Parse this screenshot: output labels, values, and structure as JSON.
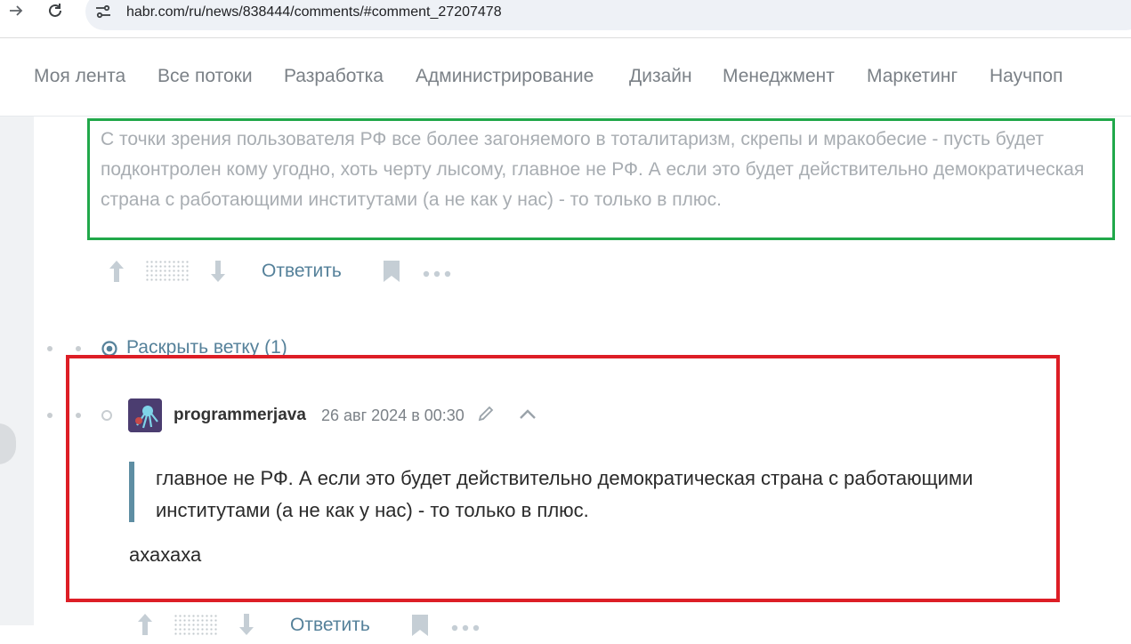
{
  "browser": {
    "url": "habr.com/ru/news/838444/comments/#comment_27207478"
  },
  "topnav": {
    "items": [
      {
        "label": "Моя лента"
      },
      {
        "label": "Все потоки"
      },
      {
        "label": "Разработка"
      },
      {
        "label": "Администрирование"
      },
      {
        "label": "Дизайн"
      },
      {
        "label": "Менеджмент"
      },
      {
        "label": "Маркетинг"
      },
      {
        "label": "Научпоп"
      }
    ]
  },
  "parent_comment": {
    "text": "С точки зрения пользователя РФ все более загоняемого в тоталитаризм, скрепы и мракобесие - пусть будет подконтролен кому угодно, хоть черту лысому, главное не РФ. А если это будет действительно демократическая страна с работающими институтами (а не как у нас) - то только в плюс.",
    "reply_label": "Ответить"
  },
  "thread": {
    "expand_label": "Раскрыть ветку (1)"
  },
  "reply_comment": {
    "author": "programmerjava",
    "timestamp": "26 авг 2024 в 00:30",
    "quote": "главное не РФ. А если это будет действительно демократическая страна с работающими институтами (а не как у нас) - то только в плюс.",
    "body": "ахахаха",
    "reply_label": "Ответить"
  },
  "colors": {
    "accent": "#55819a",
    "highlight_green": "#21a84a",
    "highlight_red": "#dd1e26"
  },
  "icons": [
    "arrow-right-icon",
    "reload-icon",
    "site-info-icon",
    "vote-up-icon",
    "vote-down-icon",
    "bookmark-icon",
    "more-icon",
    "expand-branch-icon",
    "edit-icon",
    "collapse-icon"
  ]
}
